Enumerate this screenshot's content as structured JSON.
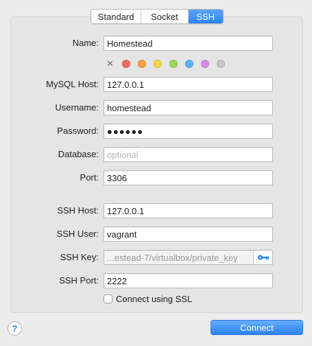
{
  "tabs": [
    "Standard",
    "Socket",
    "SSH"
  ],
  "active_tab": "SSH",
  "form": {
    "name": {
      "label": "Name:",
      "value": "Homestead"
    },
    "mysql_host": {
      "label": "MySQL Host:",
      "value": "127.0.0.1"
    },
    "username": {
      "label": "Username:",
      "value": "homestead"
    },
    "password": {
      "label": "Password:",
      "value": "●●●●●●"
    },
    "database": {
      "label": "Database:",
      "placeholder": "optional"
    },
    "port": {
      "label": "Port:",
      "value": "3306"
    },
    "ssh_host": {
      "label": "SSH Host:",
      "value": "127.0.0.1"
    },
    "ssh_user": {
      "label": "SSH User:",
      "value": "vagrant"
    },
    "ssh_key": {
      "label": "SSH Key:",
      "value": "...estead-7/virtualbox/private_key"
    },
    "ssh_port": {
      "label": "SSH Port:",
      "value": "2222"
    },
    "use_ssl": {
      "label": "Connect using SSL",
      "checked": false
    }
  },
  "color_tags": {
    "clear_icon": "x-icon",
    "colors": [
      "#ef6b5b",
      "#f5a141",
      "#f6d74b",
      "#9ad856",
      "#57b7f4",
      "#d68be6",
      "#c8c8c8"
    ]
  },
  "icons": {
    "help": "help-icon",
    "key": "key-icon"
  },
  "help_label": "?",
  "connect_button": {
    "label": "Connect"
  },
  "accent_color": "#2c82f6"
}
